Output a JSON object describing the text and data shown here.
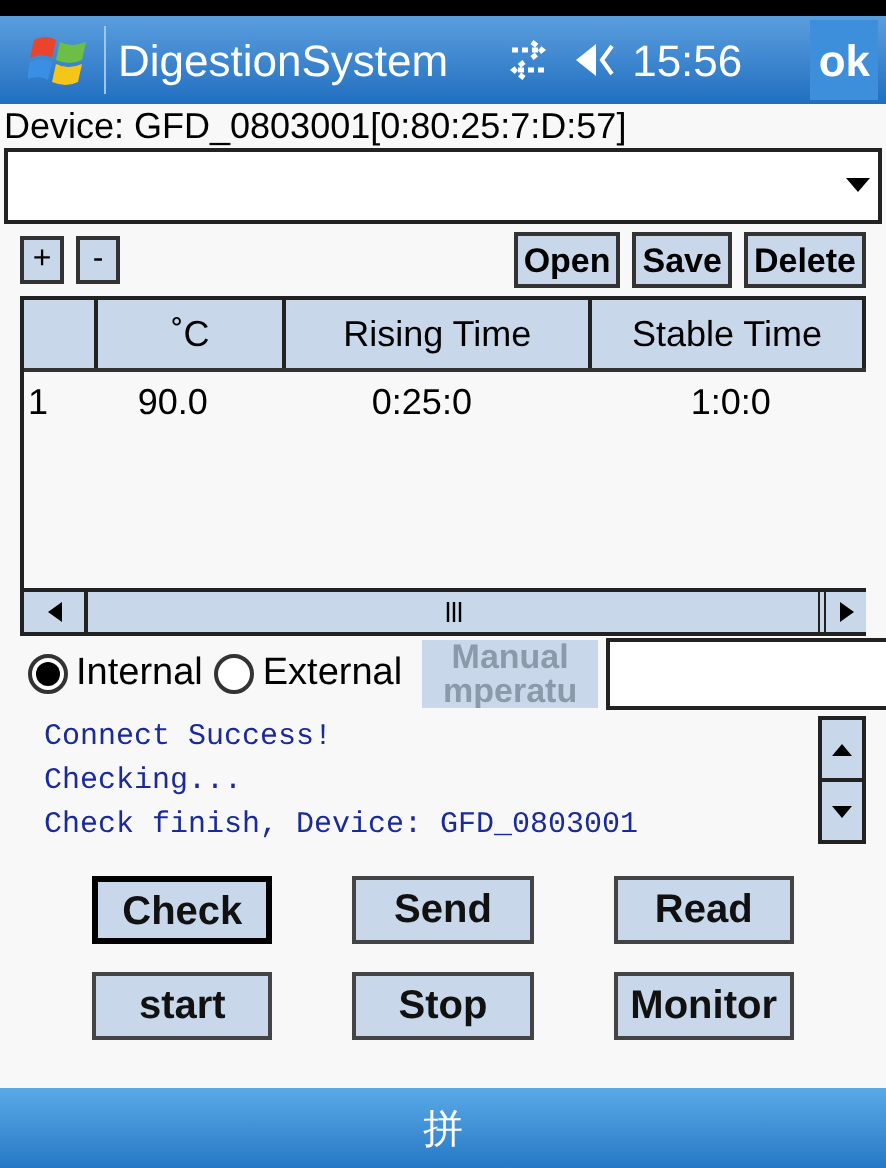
{
  "title_bar": {
    "title": "DigestionSystem",
    "time": "15:56",
    "ok": "ok"
  },
  "device_label": "Device: GFD_0803001[0:80:25:7:D:57]",
  "toolbar": {
    "left": [
      "+",
      "-"
    ],
    "right": [
      "Open",
      "Save",
      "Delete"
    ]
  },
  "table": {
    "columns": [
      "˚C",
      "Rising Time",
      "Stable Time"
    ],
    "rows": [
      {
        "index": "1",
        "cells": [
          "90.0",
          "0:25:0",
          "1:0:0"
        ]
      }
    ]
  },
  "source": [
    {
      "label": "Internal",
      "selected": true
    },
    {
      "label": "External",
      "selected": false
    }
  ],
  "manual_label": "Manual mperatu",
  "log": [
    "Connect Success!",
    "Checking...",
    "Check finish, Device: GFD_0803001"
  ],
  "buttons": [
    {
      "label": "Check",
      "selected": true
    },
    {
      "label": "Send",
      "selected": false
    },
    {
      "label": "Read",
      "selected": false
    },
    {
      "label": "start",
      "selected": false
    },
    {
      "label": "Stop",
      "selected": false
    },
    {
      "label": "Monitor",
      "selected": false
    }
  ],
  "input_panel": "拼"
}
